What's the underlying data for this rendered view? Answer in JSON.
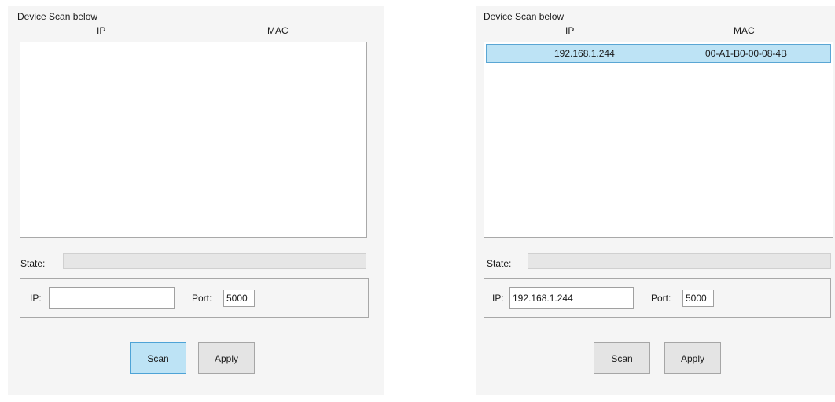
{
  "left": {
    "title": "Device Scan below",
    "col_ip": "IP",
    "col_mac": "MAC",
    "state_label": "State:",
    "ip_label": "IP:",
    "ip_value": "",
    "port_label": "Port:",
    "port_value": "5000",
    "scan_label": "Scan",
    "apply_label": "Apply"
  },
  "right": {
    "title": "Device Scan below",
    "col_ip": "IP",
    "col_mac": "MAC",
    "rows": [
      {
        "ip": "192.168.1.244",
        "mac": "00-A1-B0-00-08-4B"
      }
    ],
    "state_label": "State:",
    "ip_label": "IP:",
    "ip_value": "192.168.1.244",
    "port_label": "Port:",
    "port_value": "5000",
    "scan_label": "Scan",
    "apply_label": "Apply"
  },
  "colors": {
    "selected_row": "#bde3f5",
    "active_button": "#bde3f5"
  }
}
